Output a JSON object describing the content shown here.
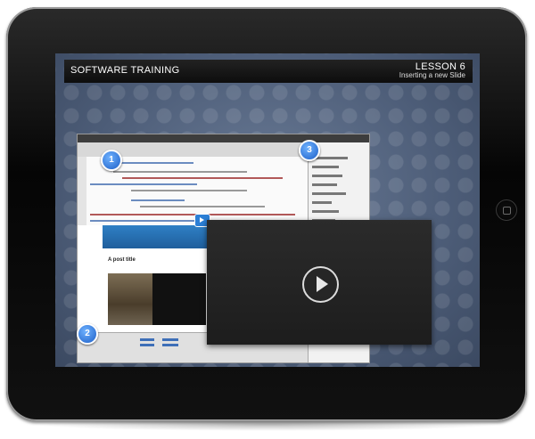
{
  "header": {
    "left_title": "SOFTWARE TRAINING",
    "lesson": "LESSON 6",
    "subtitle": "Inserting a new Slide"
  },
  "markers": [
    "1",
    "2",
    "3"
  ],
  "software": {
    "design_view": {
      "post_title": "A post title"
    }
  },
  "colors": {
    "header_bg": "#111111",
    "screen_bg": "#55667f",
    "marker_blue": "#1d5fc7"
  },
  "icons": {
    "play": "play-icon",
    "video_badge": "video-icon",
    "home": "home-button-icon"
  }
}
